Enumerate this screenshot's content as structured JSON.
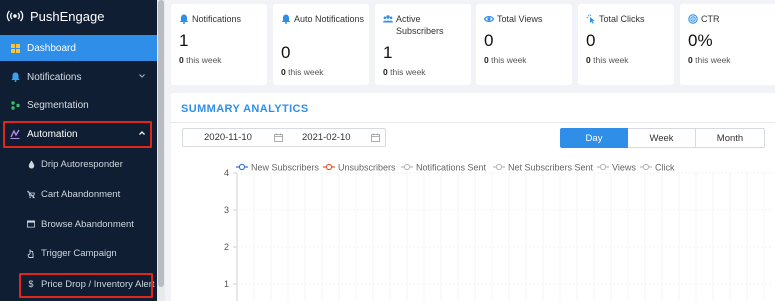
{
  "brand": {
    "name": "PushEngage"
  },
  "sidebar": {
    "items": [
      {
        "label": "Dashboard",
        "icon": "dashboard-icon"
      },
      {
        "label": "Notifications",
        "icon": "bell-icon"
      },
      {
        "label": "Segmentation",
        "icon": "segmentation-icon"
      },
      {
        "label": "Automation",
        "icon": "automation-icon"
      }
    ],
    "sub_items": [
      {
        "label": "Drip Autoresponder",
        "icon": "drop-icon"
      },
      {
        "label": "Cart Abandonment",
        "icon": "cart-off-icon"
      },
      {
        "label": "Browse Abandonment",
        "icon": "browser-icon"
      },
      {
        "label": "Trigger Campaign",
        "icon": "trigger-icon"
      },
      {
        "label": "Price Drop / Inventory Alert",
        "icon": "dollar-icon"
      }
    ]
  },
  "stats": [
    {
      "label": "Notifications",
      "value": "1",
      "week_count": "0",
      "week_label": "this week",
      "icon": "bell-icon"
    },
    {
      "label": "Auto Notifications",
      "value": "0",
      "week_count": "0",
      "week_label": "this week",
      "icon": "bell-auto-icon"
    },
    {
      "label": "Active Subscribers",
      "value": "1",
      "week_count": "0",
      "week_label": "this week",
      "icon": "users-icon"
    },
    {
      "label": "Total Views",
      "value": "0",
      "week_count": "0",
      "week_label": "this week",
      "icon": "eye-icon"
    },
    {
      "label": "Total Clicks",
      "value": "0",
      "week_count": "0",
      "week_label": "this week",
      "icon": "click-icon"
    },
    {
      "label": "CTR",
      "value": "0%",
      "week_count": "0",
      "week_label": "this week",
      "icon": "target-icon"
    }
  ],
  "analytics": {
    "title": "SUMMARY ANALYTICS",
    "date_from": "2020-11-10",
    "date_to": "2021-02-10",
    "ranges": [
      "Day",
      "Week",
      "Month"
    ],
    "active_range": "Day"
  },
  "colors": {
    "accent": "#2f8fe8",
    "sidebar_bg": "#0f1e33",
    "highlight": "#e0251b"
  },
  "chart_data": {
    "type": "line",
    "title": "",
    "xlabel": "",
    "ylabel": "",
    "ylim": [
      0,
      4
    ],
    "yticks": [
      "4",
      "3",
      "2",
      "1"
    ],
    "grid": true,
    "legend_position": "top",
    "series": [
      {
        "name": "New Subscribers",
        "color": "#2f6fd0",
        "values": []
      },
      {
        "name": "Unsubscribers",
        "color": "#e8542d",
        "values": []
      },
      {
        "name": "Notifications Sent",
        "color": "#b9b9b9",
        "values": []
      },
      {
        "name": "Net Subscribers Sent",
        "color": "#b9b9b9",
        "values": []
      },
      {
        "name": "Views",
        "color": "#b9b9b9",
        "values": []
      },
      {
        "name": "Click",
        "color": "#b9b9b9",
        "values": []
      }
    ]
  }
}
